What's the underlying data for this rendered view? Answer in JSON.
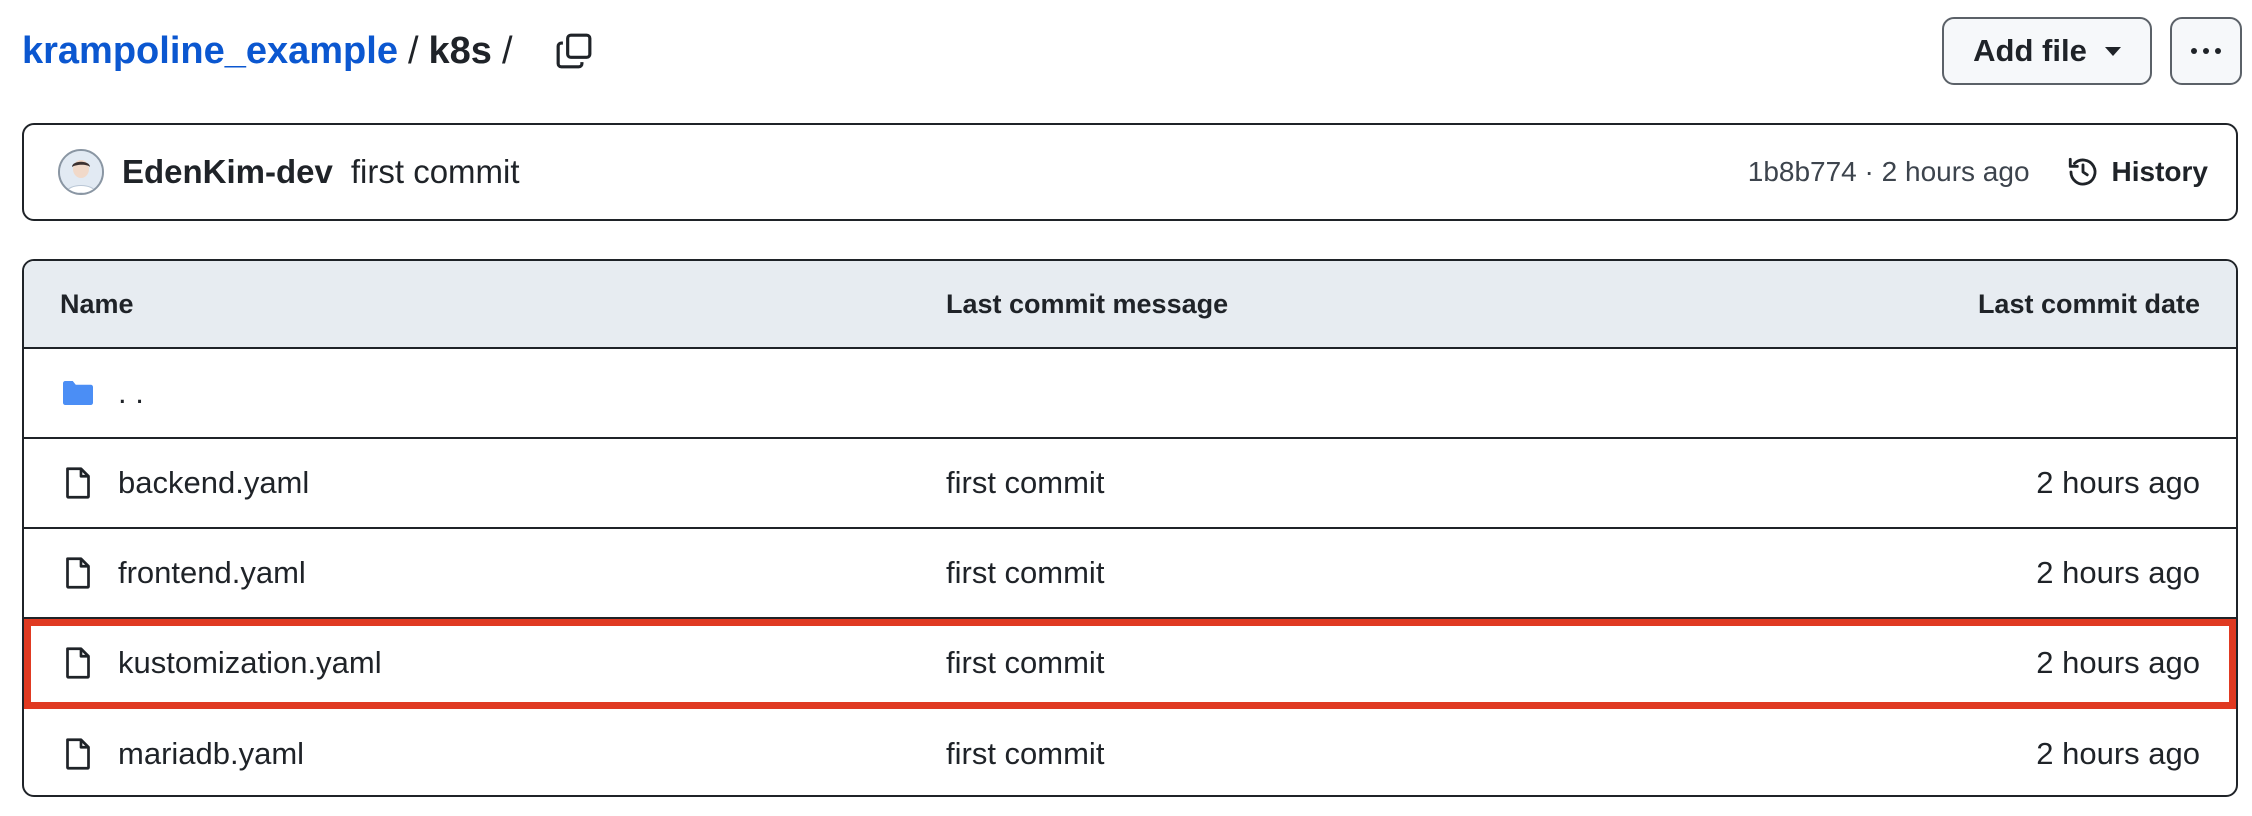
{
  "breadcrumb": {
    "repo": "krampoline_example",
    "separator": "/",
    "folder": "k8s",
    "trailing": "/"
  },
  "toolbar": {
    "add_file_label": "Add file",
    "more_icon": "kebab-horizontal-icon",
    "copy_icon": "copy-icon"
  },
  "commit": {
    "author": "EdenKim-dev",
    "message": "first commit",
    "meta": "1b8b774 · 2 hours ago",
    "history_label": "History"
  },
  "table": {
    "headers": {
      "name": "Name",
      "message": "Last commit message",
      "date": "Last commit date"
    },
    "parent": {
      "name": ". .",
      "icon": "folder-icon"
    },
    "rows": [
      {
        "name": "backend.yaml",
        "message": "first commit",
        "date": "2 hours ago",
        "icon": "file-icon",
        "highlighted": false
      },
      {
        "name": "frontend.yaml",
        "message": "first commit",
        "date": "2 hours ago",
        "icon": "file-icon",
        "highlighted": false
      },
      {
        "name": "kustomization.yaml",
        "message": "first commit",
        "date": "2 hours ago",
        "icon": "file-icon",
        "highlighted": true
      },
      {
        "name": "mariadb.yaml",
        "message": "first commit",
        "date": "2 hours ago",
        "icon": "file-icon",
        "highlighted": false
      }
    ]
  },
  "colors": {
    "link": "#0b57d0",
    "highlight": "#e03a22",
    "folder": "#4b8ef5",
    "header_bg": "#e7ecf1"
  }
}
